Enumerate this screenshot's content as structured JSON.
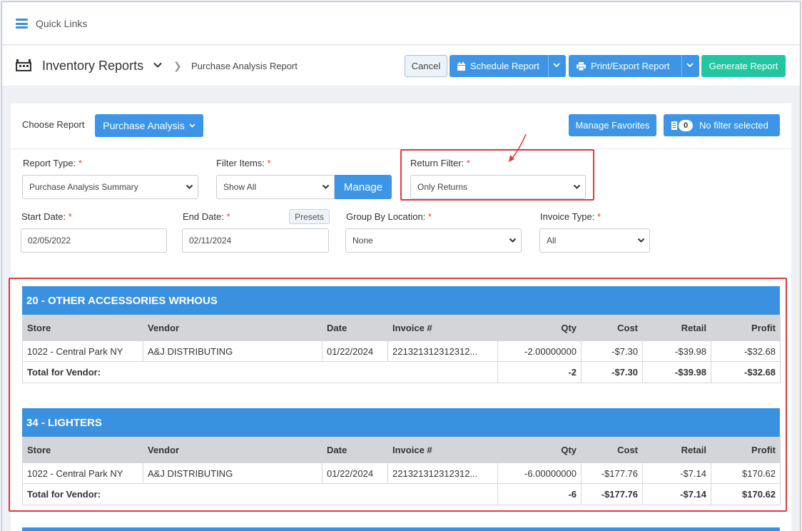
{
  "quick_links": {
    "label": "Quick Links"
  },
  "header": {
    "title": "Inventory Reports",
    "breadcrumb_current": "Purchase Analysis Report",
    "buttons": {
      "cancel": "Cancel",
      "schedule": "Schedule Report",
      "print_export": "Print/Export Report",
      "generate": "Generate Report"
    }
  },
  "chooser": {
    "label": "Choose Report",
    "selected": "Purchase Analysis",
    "manage_favorites": "Manage Favorites",
    "filter_count": "0",
    "filter_status": "No filter selected"
  },
  "filters": {
    "report_type": {
      "label": "Report Type:",
      "value": "Purchase Analysis Summary"
    },
    "filter_items": {
      "label": "Filter Items:",
      "value": "Show All",
      "manage": "Manage"
    },
    "return_filter": {
      "label": "Return Filter:",
      "value": "Only Returns"
    },
    "start_date": {
      "label": "Start Date:",
      "value": "02/05/2022"
    },
    "end_date": {
      "label": "End Date:",
      "value": "02/11/2024",
      "presets": "Presets"
    },
    "group_by_location": {
      "label": "Group By Location:",
      "value": "None"
    },
    "invoice_type": {
      "label": "Invoice Type:",
      "value": "All"
    },
    "required_mark": "*"
  },
  "results": {
    "columns": [
      "Store",
      "Vendor",
      "Date",
      "Invoice #",
      "Qty",
      "Cost",
      "Retail",
      "Profit"
    ],
    "total_label": "Total for Vendor:",
    "sections": [
      {
        "title": "20 - OTHER ACCESSORIES WRHOUS",
        "rows": [
          {
            "store": "1022 - Central Park NY",
            "vendor": "A&J DISTRIBUTING",
            "date": "01/22/2024",
            "invoice": "221321312312312...",
            "qty": "-2.00000000",
            "cost": "-$7.30",
            "retail": "-$39.98",
            "profit": "-$32.68"
          }
        ],
        "total": {
          "qty": "-2",
          "cost": "-$7.30",
          "retail": "-$39.98",
          "profit": "-$32.68"
        }
      },
      {
        "title": "34 - LIGHTERS",
        "rows": [
          {
            "store": "1022 - Central Park NY",
            "vendor": "A&J DISTRIBUTING",
            "date": "01/22/2024",
            "invoice": "221321312312312...",
            "qty": "-6.00000000",
            "cost": "-$177.76",
            "retail": "-$7.14",
            "profit": "$170.62"
          }
        ],
        "total": {
          "qty": "-6",
          "cost": "-$177.76",
          "retail": "-$7.14",
          "profit": "$170.62"
        }
      }
    ]
  },
  "colors": {
    "primary_blue": "#3d95e8",
    "teal": "#22c6a0",
    "annotation_red": "#e0393f",
    "section_header": "#3a91e0"
  },
  "icons": {
    "menu": "hamburger-menu-icon",
    "reports": "inventory-report-icon",
    "calendar": "calendar-icon",
    "printer": "printer-icon",
    "filter_list": "filter-list-icon"
  }
}
